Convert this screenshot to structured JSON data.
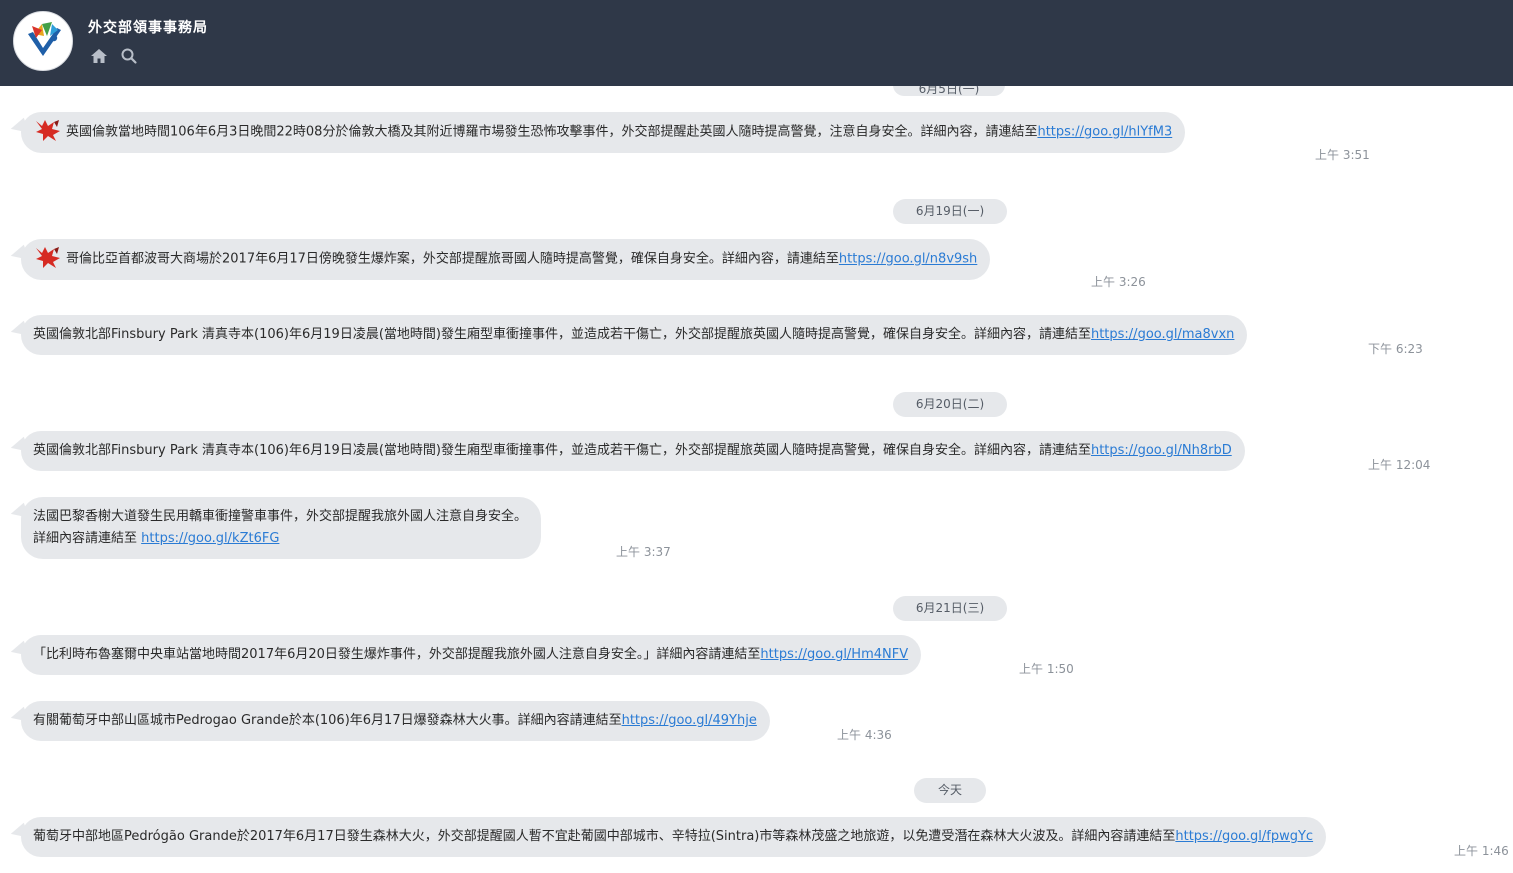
{
  "header": {
    "title": "外交部領事事務局",
    "icons": [
      "home-icon",
      "search-icon"
    ]
  },
  "colors": {
    "topbar": "#2f3848",
    "bubble": "#e6e8eb",
    "link": "#2a7bd4",
    "time": "#8c929a"
  },
  "dates": {
    "d0": "6月5日(一)",
    "d1": "6月19日(一)",
    "d2": "6月20日(二)",
    "d3": "6月21日(三)",
    "d4": "今天"
  },
  "messages": [
    {
      "text": "英國倫敦當地時間106年6月3日晚間22時08分於倫敦大橋及其附近博羅市場發生恐怖攻擊事件，外交部提醒赴英國人隨時提高警覺，注意自身安全。詳細內容，請連結至",
      "link": "https://goo.gl/hlYfM3",
      "time": "上午 3:51",
      "has_sticker": true
    },
    {
      "text": "哥倫比亞首都波哥大商場於2017年6月17日傍晚發生爆炸案，外交部提醒旅哥國人隨時提高警覺，確保自身安全。詳細內容，請連結至",
      "link": "https://goo.gl/n8v9sh",
      "time": "上午 3:26",
      "has_sticker": true
    },
    {
      "text": "英國倫敦北部Finsbury Park 清真寺本(106)年6月19日凌晨(當地時間)發生廂型車衝撞事件，並造成若干傷亡，外交部提醒旅英國人隨時提高警覺，確保自身安全。詳細內容，請連結至",
      "link": "https://goo.gl/ma8vxn",
      "time": "下午 6:23"
    },
    {
      "text": "英國倫敦北部Finsbury Park 清真寺本(106)年6月19日凌晨(當地時間)發生廂型車衝撞事件，並造成若干傷亡，外交部提醒旅英國人隨時提高警覺，確保自身安全。詳細內容，請連結至",
      "link": "https://goo.gl/Nh8rbD",
      "time": "上午 12:04"
    },
    {
      "text": "法國巴黎香榭大道發生民用轎車衝撞警車事件，外交部提醒我旅外國人注意自身安全。",
      "text2": "詳細內容請連結至 ",
      "link": "https://goo.gl/kZt6FG",
      "time": "上午 3:37"
    },
    {
      "text": "「比利時布魯塞爾中央車站當地時間2017年6月20日發生爆炸事件，外交部提醒我旅外國人注意自身安全。」詳細內容請連結至",
      "link": "https://goo.gl/Hm4NFV",
      "time": "上午 1:50"
    },
    {
      "text": "有關葡萄牙中部山區城市Pedrogao Grande於本(106)年6月17日爆發森林大火事。詳細內容請連結至",
      "link": "https://goo.gl/49Yhje",
      "time": "上午 4:36"
    },
    {
      "text": "葡萄牙中部地區Pedrógão Grande於2017年6月17日發生森林大火，外交部提醒國人暫不宜赴葡國中部城市、辛特拉(Sintra)市等森林茂盛之地旅遊，以免遭受潛在森林大火波及。詳細內容請連結至",
      "link": "https://goo.gl/fpwgYc",
      "time": "上午 1:46"
    }
  ]
}
